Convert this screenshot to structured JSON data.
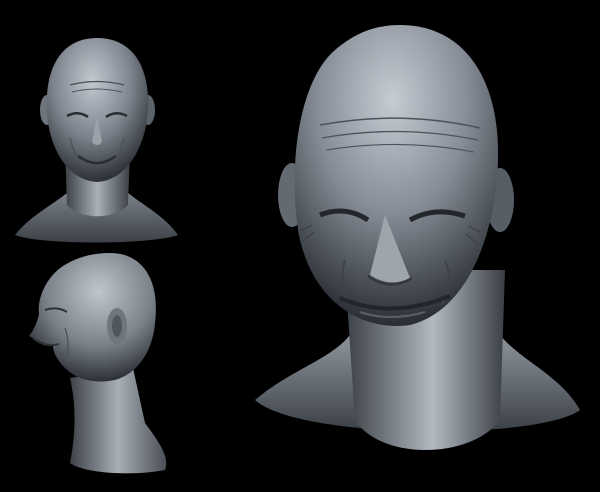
{
  "scene": {
    "background": "#000000",
    "material_colors": {
      "clay_light": "#b8bec6",
      "clay_mid": "#7d848d",
      "clay_dark": "#3e434a",
      "shadow": "#1a1c20"
    }
  },
  "views": [
    {
      "id": "front",
      "label": "",
      "icon": "sculpted-head-front-icon"
    },
    {
      "id": "side",
      "label": "",
      "icon": "sculpted-head-profile-icon"
    },
    {
      "id": "main",
      "label": "",
      "icon": "sculpted-head-closeup-icon"
    }
  ]
}
